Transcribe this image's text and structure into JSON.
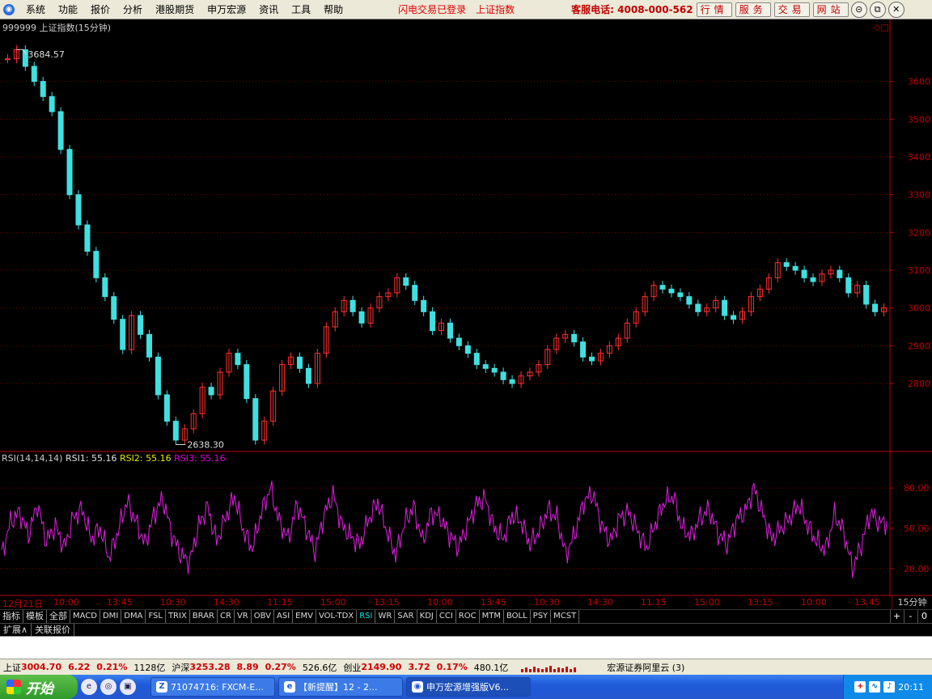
{
  "menu": {
    "items": [
      "系统",
      "功能",
      "报价",
      "分析",
      "港股期货",
      "申万宏源",
      "资讯",
      "工具",
      "帮助"
    ],
    "notice": "闪电交易已登录",
    "current": "上证指数",
    "phone": "客服电话: 4008-000-562",
    "right_buttons": [
      "行情",
      "服务",
      "交易",
      "网站"
    ],
    "window_buttons": [
      "restore-icon",
      "maximize-icon",
      "close-icon"
    ]
  },
  "chart_title": "999999 上证指数(15分钟)",
  "rsi": {
    "params": "RSI(14,14,14)",
    "rsi1_label": "RSI1:",
    "rsi1": "55.16",
    "rsi2_label": "RSI2:",
    "rsi2": "55.16",
    "rsi3_label": "RSI3:",
    "rsi3": "55.16",
    "color_rsi1": "#e0e0e0",
    "color_rsi2": "#e8e800",
    "color_rsi3": "#e000e0"
  },
  "chart_data": [
    {
      "type": "candlestick",
      "title": "999999 上证指数(15分钟)",
      "y_ticks": [
        2800,
        2900,
        3000,
        3100,
        3200,
        3300,
        3400,
        3500,
        3600
      ],
      "ylim": [
        2620,
        3700
      ],
      "annotations": [
        {
          "label": "3684.57",
          "value": 3684.57,
          "kind": "high"
        },
        {
          "label": "2638.30",
          "value": 2638.3,
          "kind": "low"
        }
      ],
      "series": [
        {
          "name": "close",
          "values": [
            3660,
            3684,
            3640,
            3600,
            3560,
            3520,
            3420,
            3300,
            3220,
            3150,
            3080,
            3030,
            2970,
            2890,
            2980,
            2930,
            2870,
            2770,
            2700,
            2650,
            2680,
            2720,
            2790,
            2770,
            2830,
            2880,
            2850,
            2760,
            2650,
            2700,
            2780,
            2850,
            2870,
            2840,
            2800,
            2880,
            2950,
            2990,
            3020,
            2990,
            2960,
            3000,
            3030,
            3040,
            3080,
            3060,
            3020,
            2990,
            2940,
            2960,
            2920,
            2900,
            2880,
            2850,
            2840,
            2830,
            2810,
            2800,
            2820,
            2830,
            2850,
            2890,
            2920,
            2930,
            2910,
            2870,
            2860,
            2880,
            2900,
            2920,
            2960,
            2990,
            3030,
            3060,
            3050,
            3040,
            3030,
            3010,
            2990,
            3000,
            3020,
            2980,
            2970,
            2990,
            3030,
            3050,
            3080,
            3120,
            3110,
            3100,
            3080,
            3070,
            3090,
            3100,
            3080,
            3040,
            3060,
            3010,
            2990,
            3000
          ]
        }
      ]
    },
    {
      "type": "line",
      "title": "RSI(14,14,14)",
      "y_ticks": [
        20,
        50,
        80
      ],
      "ylim": [
        0,
        100
      ],
      "series": [
        {
          "name": "RSI3",
          "values": [
            30,
            55,
            62,
            45,
            68,
            40,
            52,
            35,
            58,
            64,
            42,
            50,
            28,
            48,
            70,
            55,
            38,
            60,
            72,
            46,
            30,
            25,
            52,
            66,
            40,
            58,
            74,
            48,
            35,
            62,
            80,
            55,
            42,
            68,
            50,
            33,
            60,
            75,
            52,
            44,
            38,
            57,
            70,
            48,
            30,
            54,
            66,
            40,
            62,
            58,
            45,
            36,
            52,
            68,
            72,
            50,
            42,
            60,
            55,
            38,
            48,
            64,
            58,
            30,
            46,
            70,
            76,
            52,
            40,
            58,
            62,
            48,
            35,
            54,
            70,
            74,
            50,
            44,
            58,
            64,
            46,
            38,
            56,
            62,
            80,
            60,
            42,
            50,
            58,
            68,
            52,
            40,
            34,
            60,
            48,
            20,
            38,
            62,
            54,
            55
          ]
        }
      ]
    }
  ],
  "time_axis": {
    "labels": [
      "12月21日",
      "10:00",
      "13:45",
      "10:30",
      "14:30",
      "11:15",
      "15:00",
      "13:15",
      "10:00",
      "13:45",
      "10:30",
      "14:30",
      "11:15",
      "15:00",
      "13:15",
      "10:00",
      "13:45"
    ],
    "period": "15分钟"
  },
  "indicator_tabs": [
    "指标",
    "模板",
    "全部",
    "MACD",
    "DMI",
    "DMA",
    "FSL",
    "TRIX",
    "BRAR",
    "CR",
    "VR",
    "OBV",
    "ASI",
    "EMV",
    "VOL-TDX",
    "RSI",
    "WR",
    "SAR",
    "KDJ",
    "CCI",
    "ROC",
    "MTM",
    "BOLL",
    "PSY",
    "MCST"
  ],
  "active_indicator": "RSI",
  "tab_controls": [
    "+",
    "-",
    "0"
  ],
  "ext_tabs": [
    "扩展∧",
    "关联报价"
  ],
  "status": {
    "sh_label": "上证",
    "sh_value": "3004.70",
    "sh_change": "6.22",
    "sh_pct": "0.21%",
    "sh_amount": "1128亿",
    "hs_label": "沪深",
    "hs_value": "3253.28",
    "hs_change": "8.89",
    "hs_pct": "0.27%",
    "hs_amount": "526.6亿",
    "cy_label": "创业",
    "cy_value": "2149.90",
    "cy_change": "3.72",
    "cy_pct": "0.17%",
    "cy_amount": "480.1亿",
    "server": "宏源证券阿里云 (3)"
  },
  "taskbar": {
    "start": "开始",
    "tasks": [
      "71074716: FXCM-E...",
      "【新提醒】12 - 2...",
      "申万宏源增强版V6..."
    ],
    "clock": "20:11"
  },
  "colors": {
    "up": "#ff3030",
    "down": "#40e0e0",
    "rsi_line": "#e020e0",
    "grid": "#800000",
    "axis": "#c00000"
  }
}
